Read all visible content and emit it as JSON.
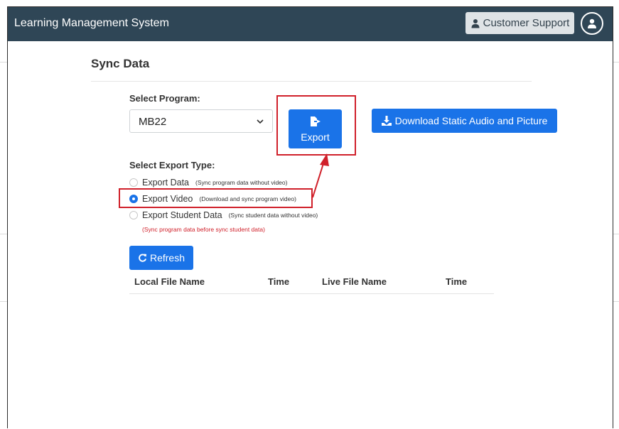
{
  "header": {
    "title": "Learning Management System",
    "support_label": "Customer Support",
    "support_icon": "user-headset-icon",
    "avatar_icon": "user-circle-icon"
  },
  "main": {
    "title": "Sync Data",
    "program_label": "Select Program:",
    "program_value": "MB22",
    "export_label": "Export",
    "export_icon": "file-export-icon",
    "download_label": "Download Static Audio and Picture",
    "download_icon": "download-icon",
    "export_type_label": "Select Export Type:",
    "options": [
      {
        "label": "Export Data",
        "hint": "(Sync program data without video)",
        "checked": false
      },
      {
        "label": "Export Video",
        "hint": "(Download and sync program video)",
        "checked": true
      },
      {
        "label": "Export Student Data",
        "hint": "(Sync student data without video)",
        "checked": false
      }
    ],
    "warning": "(Sync program data before sync student data)",
    "refresh_label": "Refresh",
    "refresh_icon": "refresh-icon",
    "table_headers": [
      "Local File Name",
      "Time",
      "Live File Name",
      "Time"
    ]
  },
  "colors": {
    "topbar": "#2f4656",
    "primary": "#1a73e8",
    "highlight": "#d0202a"
  }
}
